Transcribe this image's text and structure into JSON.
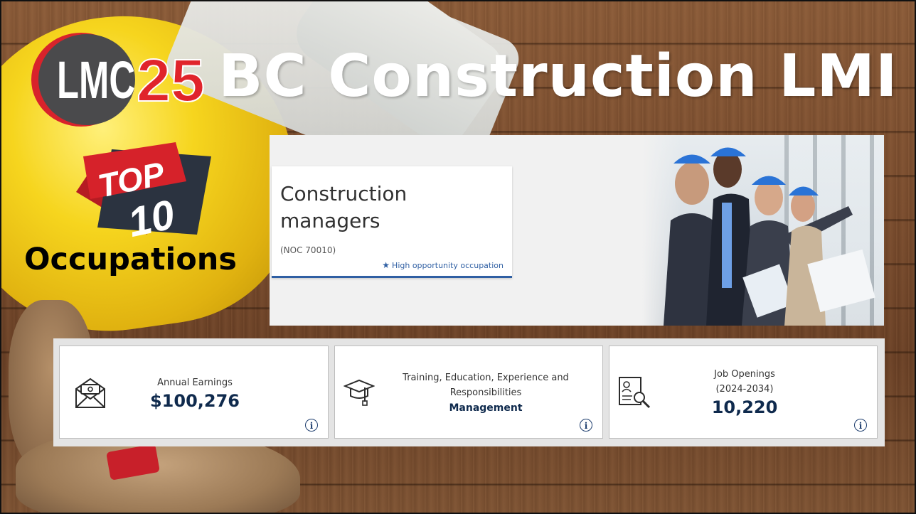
{
  "slide": {
    "logo_text_lmc": "LMC",
    "logo_text_25": "25",
    "title": "BC Construction LMI",
    "badge_top": "TOP",
    "badge_number": "10",
    "subtitle": "Occupations"
  },
  "occupation": {
    "name": "Construction managers",
    "noc": "(NOC 70010)",
    "tag": "High opportunity occupation",
    "tag_icon": "star-icon"
  },
  "stats": [
    {
      "icon": "envelope-money-icon",
      "label": "Annual Earnings",
      "value": "$100,276"
    },
    {
      "icon": "graduation-cap-icon",
      "label": "Training, Education, Experience and Responsibilities",
      "value": "Management"
    },
    {
      "icon": "document-search-icon",
      "label": "Job Openings",
      "sublabel": "(2024-2034)",
      "value": "10,220"
    }
  ],
  "info_icon": "info-icon",
  "colors": {
    "accent_blue": "#2f5fa3",
    "value_navy": "#0f2a4d",
    "logo_red": "#e0242b",
    "helmet_yellow": "#f6d51e"
  }
}
